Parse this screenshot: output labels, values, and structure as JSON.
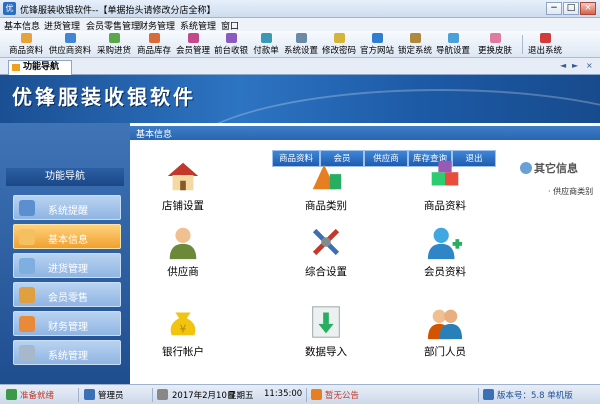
{
  "window": {
    "title": "优锋服装收银软件--【单据抬头请修改分店全称】",
    "min": "−",
    "max": "□",
    "close": "×"
  },
  "menu": [
    "基本信息",
    "进货管理",
    "会员零售管理",
    "财务管理",
    "系统管理",
    "窗口"
  ],
  "toolbar": [
    "商品资料",
    "供应商资料",
    "采购进货",
    "商品库存",
    "会员管理",
    "前台收银",
    "付款单",
    "系统设置",
    "修改密码",
    "官方网站",
    "锁定系统",
    "导航设置",
    "更换皮肤",
    "退出系统"
  ],
  "tab": {
    "label": "功能导航",
    "nav_prev": "◄",
    "nav_next": "►",
    "nav_close": "×"
  },
  "banner": {
    "title": "优锋服装收银软件"
  },
  "leftnav": {
    "heading": "功能导航",
    "items": [
      "系统提醒",
      "基本信息",
      "进货管理",
      "会员零售",
      "财务管理",
      "系统管理"
    ]
  },
  "content": {
    "header": "基本信息",
    "quick": [
      "商品资料",
      "会员",
      "供应商",
      "库存查询",
      "退出"
    ],
    "items": [
      "店铺设置",
      "商品类别",
      "商品资料",
      "供应商",
      "综合设置",
      "会员资料",
      "银行帐户",
      "数据导入",
      "部门人员"
    ],
    "side_title": "其它信息",
    "side_list": [
      "· 供应商类别"
    ]
  },
  "status": {
    "ready": "准备就绪",
    "user": "管理员",
    "date": "2017年2月10日",
    "weekday": "星期五",
    "time": "11:35:00",
    "notice": "暂无公告",
    "version": "版本号：5.8 单机版"
  }
}
